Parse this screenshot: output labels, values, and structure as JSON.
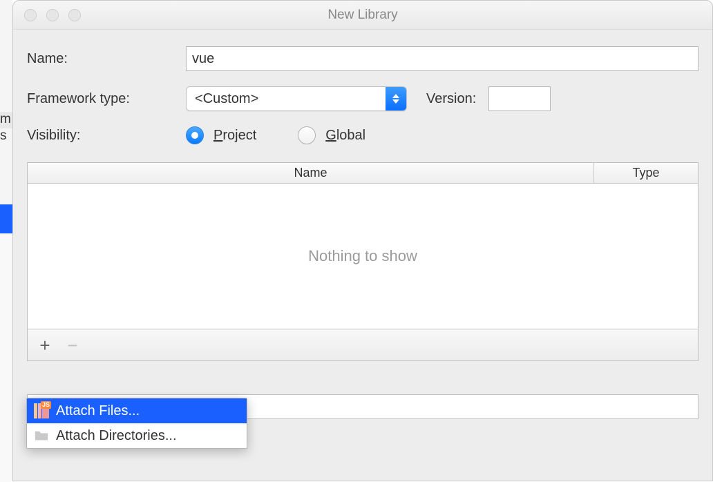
{
  "window": {
    "title": "New Library"
  },
  "form": {
    "name_label": "Name:",
    "name_value": "vue",
    "framework_label": "Framework type:",
    "framework_value": "<Custom>",
    "version_label": "Version:",
    "version_value": "",
    "visibility_label": "Visibility:",
    "visibility_options": {
      "project_prefix": "P",
      "project_rest": "roject",
      "global_prefix": "G",
      "global_rest": "lobal"
    },
    "visibility_selected": "project"
  },
  "table": {
    "columns": {
      "name": "Name",
      "type": "Type"
    },
    "empty_text": "Nothing to show"
  },
  "toolbar": {
    "add": "+",
    "remove": "−"
  },
  "popup": {
    "attach_files": "Attach Files...",
    "attach_directories": "Attach Directories...",
    "js_badge": "JS"
  }
}
